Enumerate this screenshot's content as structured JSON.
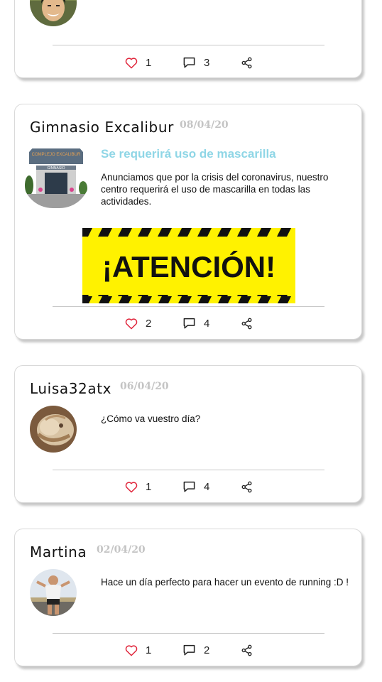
{
  "posts": [
    {
      "author": "",
      "date": "",
      "text": "",
      "likes": "1",
      "comments": "3",
      "avatar_icon": "man-portrait-avatar"
    },
    {
      "author": "Gimnasio Excalibur",
      "date": "08/04/20",
      "title": "Se requerirá uso de mascarilla",
      "text": "Anunciamos que por la crisis del coronavirus, nuestro centro requerirá el uso de mascarilla en todas las actividades.",
      "avatar_sign_top": "COMPLEJO EXCALIBUR",
      "avatar_sign": "GIMNASIO",
      "banner_text": "¡ATENCIÓN!",
      "banner_colors": {
        "background": "#fff200",
        "stripe": "#111111"
      },
      "likes": "2",
      "comments": "4"
    },
    {
      "author": "Luisa32atx",
      "date": "06/04/20",
      "text": "¿Cómo va vuestro día?",
      "likes": "1",
      "comments": "4",
      "avatar_icon": "cat-portrait-avatar"
    },
    {
      "author": "Martina",
      "date": "02/04/20",
      "text": "Hace un día perfecto para hacer un evento de running :D !",
      "likes": "1",
      "comments": "2",
      "avatar_icon": "runner-portrait-avatar"
    }
  ],
  "colors": {
    "like_heart": "#e0243a",
    "title_accent": "#8fd6e6",
    "date_gray": "#c4c4c4"
  },
  "icons": [
    "heart-icon",
    "comment-icon",
    "share-icon"
  ]
}
